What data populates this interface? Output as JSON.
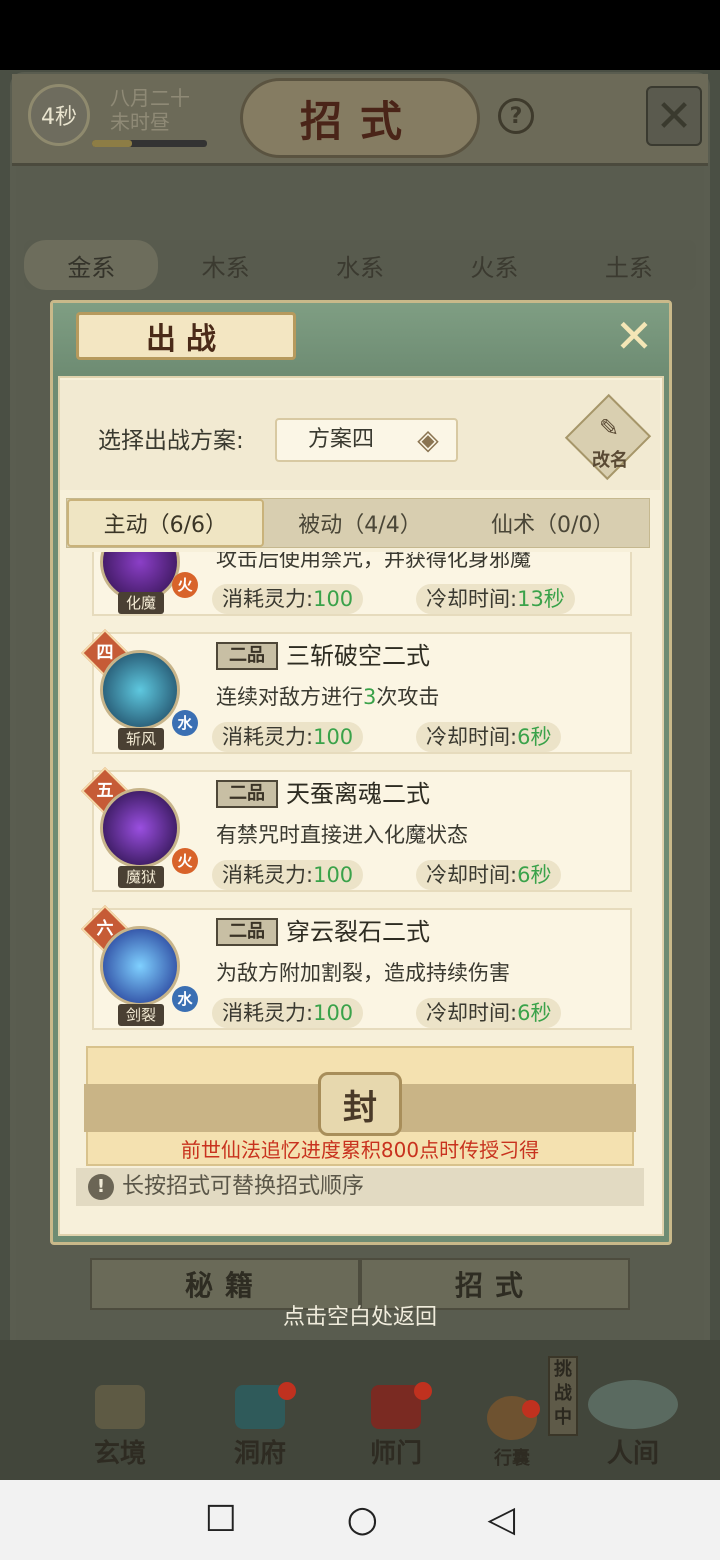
{
  "header": {
    "timer": "4秒",
    "date_line1": "八月二十",
    "date_line2": "未时昼",
    "title": "招式",
    "help": "?",
    "close": "✕"
  },
  "element_tabs": [
    "金系",
    "木系",
    "水系",
    "火系",
    "土系"
  ],
  "modal": {
    "title": "出战",
    "close": "✕",
    "plan_label": "选择出战方案:",
    "plan_value": "方案四",
    "rename_label": "改名",
    "skill_tabs": [
      "主动（6/6）",
      "被动（4/4）",
      "仙术（0/0）"
    ],
    "cost_label": "消耗灵力:",
    "cooldown_label": "冷却时间:",
    "skills": [
      {
        "rank": "",
        "grade": "",
        "name": "",
        "desc": "攻击后使用禁咒，并获得化身邪魔",
        "icon_label": "化魔",
        "element": "火",
        "cost": "100",
        "cooldown": "13秒"
      },
      {
        "rank": "四",
        "grade": "二品",
        "name": "三斩破空二式",
        "desc_pre": "连续对敌方进行",
        "desc_num": "3",
        "desc_post": "次攻击",
        "icon_label": "斩风",
        "element": "水",
        "cost": "100",
        "cooldown": "6秒"
      },
      {
        "rank": "五",
        "grade": "二品",
        "name": "天蚕离魂二式",
        "desc": "有禁咒时直接进入化魔状态",
        "icon_label": "魔狱",
        "element": "火",
        "cost": "100",
        "cooldown": "6秒"
      },
      {
        "rank": "六",
        "grade": "二品",
        "name": "穿云裂石二式",
        "desc": "为敌方附加割裂，造成持续伤害",
        "icon_label": "剑裂",
        "element": "水",
        "cost": "100",
        "cooldown": "6秒"
      }
    ],
    "sealed": {
      "seal_char": "封",
      "text": "前世仙法追忆进度累积800点时传授习得"
    },
    "hint": "长按招式可替换招式顺序"
  },
  "bottom_tabs": [
    "秘籍",
    "招式"
  ],
  "return_hint": "点击空白处返回",
  "nav": {
    "items": [
      "玄境",
      "洞府",
      "师门",
      "行囊",
      "人间"
    ],
    "challenge_badge": "挑战中"
  },
  "colors": {
    "accent_green": "#3aa24a",
    "seal_red": "#c8321e",
    "fire": "#d8632a",
    "water": "#3a6fb3"
  }
}
